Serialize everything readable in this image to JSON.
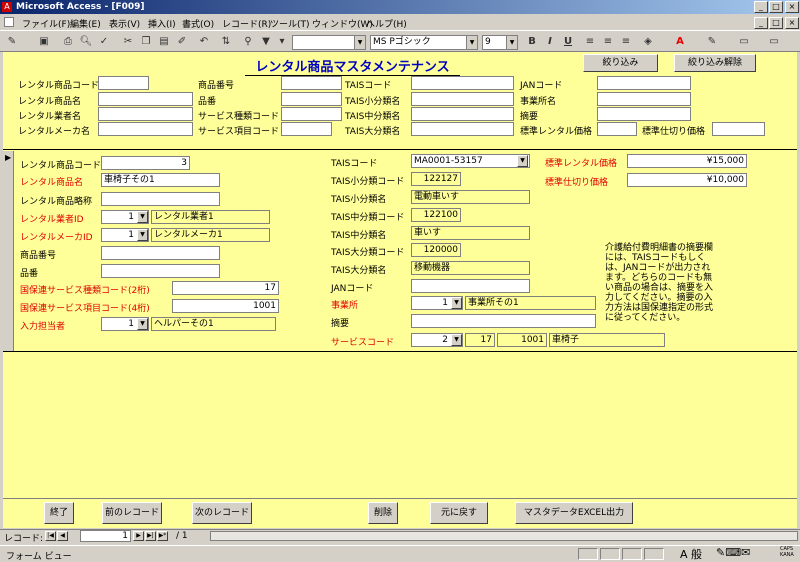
{
  "window": {
    "title": "Microsoft Access - [F009]",
    "min": "_",
    "max": "□",
    "close": "×"
  },
  "menu": [
    "ファイル(F)",
    "編集(E)",
    "表示(V)",
    "挿入(I)",
    "書式(O)",
    "レコード(R)",
    "ツール(T)",
    "ウィンドウ(W)",
    "ヘルプ(H)"
  ],
  "toolbar": {
    "font": "MS Pゴシック",
    "size": "9",
    "bold": "B",
    "italic": "I",
    "underline": "U"
  },
  "form": {
    "title": "レンタル商品マスタメンテナンス",
    "filter_btn": "絞り込み",
    "filter_clear_btn": "絞り込み解除",
    "search": {
      "l1": "レンタル商品コード",
      "l2": "レンタル商品名",
      "l3": "レンタル業者名",
      "l4": "レンタルメーカ名",
      "l5": "商品番号",
      "l6": "品番",
      "l7": "サービス種類コード",
      "l8": "サービス項目コード",
      "l9": "TAISコード",
      "l10": "TAIS小分類名",
      "l11": "TAIS中分類名",
      "l12": "TAIS大分類名",
      "l13": "JANコード",
      "l14": "事業所名",
      "l15": "摘要",
      "l16": "標準レンタル価格",
      "l17": "標準仕切り価格"
    },
    "d": {
      "code_l": "レンタル商品コード",
      "code": "3",
      "name_l": "レンタル商品名",
      "name": "車椅子その1",
      "abbr_l": "レンタル商品略称",
      "abbr": "",
      "vendor_l": "レンタル業者ID",
      "vendor_id": "1",
      "vendor_name": "レンタル業者1",
      "maker_l": "レンタルメーカID",
      "maker_id": "1",
      "maker_name": "レンタルメーカ1",
      "prodno_l": "商品番号",
      "prodno": "",
      "partno_l": "品番",
      "partno": "",
      "svc_type_l": "国保連サービス種類コード(2桁)",
      "svc_type": "17",
      "svc_item_l": "国保連サービス項目コード(4桁)",
      "svc_item": "1001",
      "staff_l": "入力担当者",
      "staff_id": "1",
      "staff_name": "ヘルパーその1",
      "tais_l": "TAISコード",
      "tais": "MA0001-53157",
      "tais_s_code_l": "TAIS小分類コード",
      "tais_s_code": "122127",
      "tais_s_name_l": "TAIS小分類名",
      "tais_s_name": "電動車いす",
      "tais_m_code_l": "TAIS中分類コード",
      "tais_m_code": "122100",
      "tais_m_name_l": "TAIS中分類名",
      "tais_m_name": "車いす",
      "tais_l_code_l": "TAIS大分類コード",
      "tais_l_code": "120000",
      "tais_l_name_l": "TAIS大分類名",
      "tais_l_name": "移動機器",
      "jan_l": "JANコード",
      "jan": "",
      "office_l": "事業所",
      "office_id": "1",
      "office_name": "事業所その1",
      "memo_l": "摘要",
      "memo": "",
      "svc_l": "サービスコード",
      "svc_id": "2",
      "svc_type2": "17",
      "svc_item2": "1001",
      "svc_name": "車椅子",
      "price_l": "標準レンタル価格",
      "price": "¥15,000",
      "cost_l": "標準仕切り価格",
      "cost": "¥10,000",
      "note": "介護給付費明細書の摘要欄には、TAISコードもしくは、JANコードが出力されます。どちらのコードも無い商品の場合は、摘要を入力してください。摘要の入力方法は国保連指定の形式に従ってください。"
    },
    "footer": {
      "close": "終了",
      "prev": "前のレコード",
      "next": "次のレコード",
      "del": "削除",
      "undo": "元に戻す",
      "excel": "マスタデータEXCEL出力"
    }
  },
  "nav": {
    "label": "レコード:",
    "current": "1",
    "total": "/ 1"
  },
  "status": {
    "text": "フォーム ビュー",
    "caps": "CAPS",
    "kana": "KANA"
  }
}
